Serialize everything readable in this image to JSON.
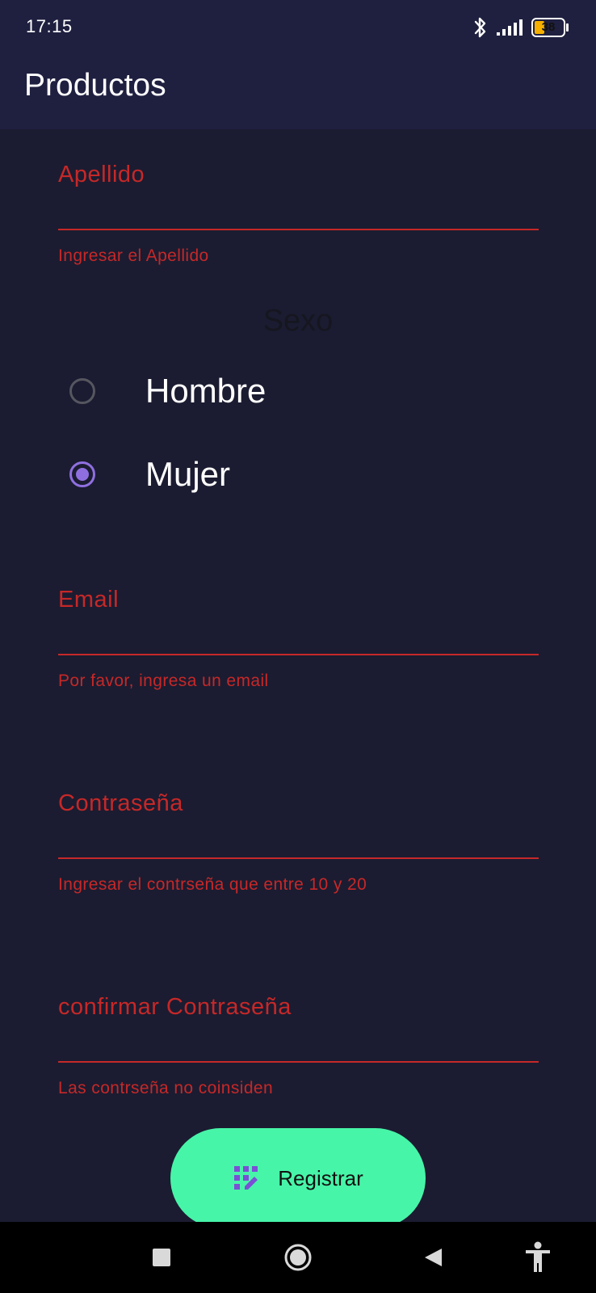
{
  "status_bar": {
    "time": "17:15",
    "battery_level": "38",
    "icons": [
      "bluetooth-icon",
      "signal-icon",
      "battery-icon"
    ]
  },
  "app_bar": {
    "title": "Productos"
  },
  "form": {
    "apellido": {
      "label": "Apellido",
      "value": "",
      "helper": "Ingresar el Apellido"
    },
    "sexo": {
      "title": "Sexo",
      "options": [
        {
          "label": "Hombre",
          "selected": false
        },
        {
          "label": "Mujer",
          "selected": true
        }
      ]
    },
    "email": {
      "label": "Email",
      "value": "",
      "helper": "Por favor, ingresa un email"
    },
    "password": {
      "label": "Contraseña",
      "value": "",
      "helper": "Ingresar el contrseña que entre 10 y 20"
    },
    "confirm_password": {
      "label": "confirmar Contraseña",
      "value": "",
      "helper": "Las contrseña no coinsiden"
    }
  },
  "register_button": {
    "label": "Registrar",
    "icon": "app-registration-icon"
  },
  "nav_bar": {
    "buttons": [
      "recents-icon",
      "home-icon",
      "back-icon",
      "accessibility-icon"
    ]
  },
  "colors": {
    "background": "#1b1c31",
    "app_bar": "#1f2040",
    "error": "#c62828",
    "radio_accent": "#8f6fe0",
    "button": "#47f5a8"
  }
}
